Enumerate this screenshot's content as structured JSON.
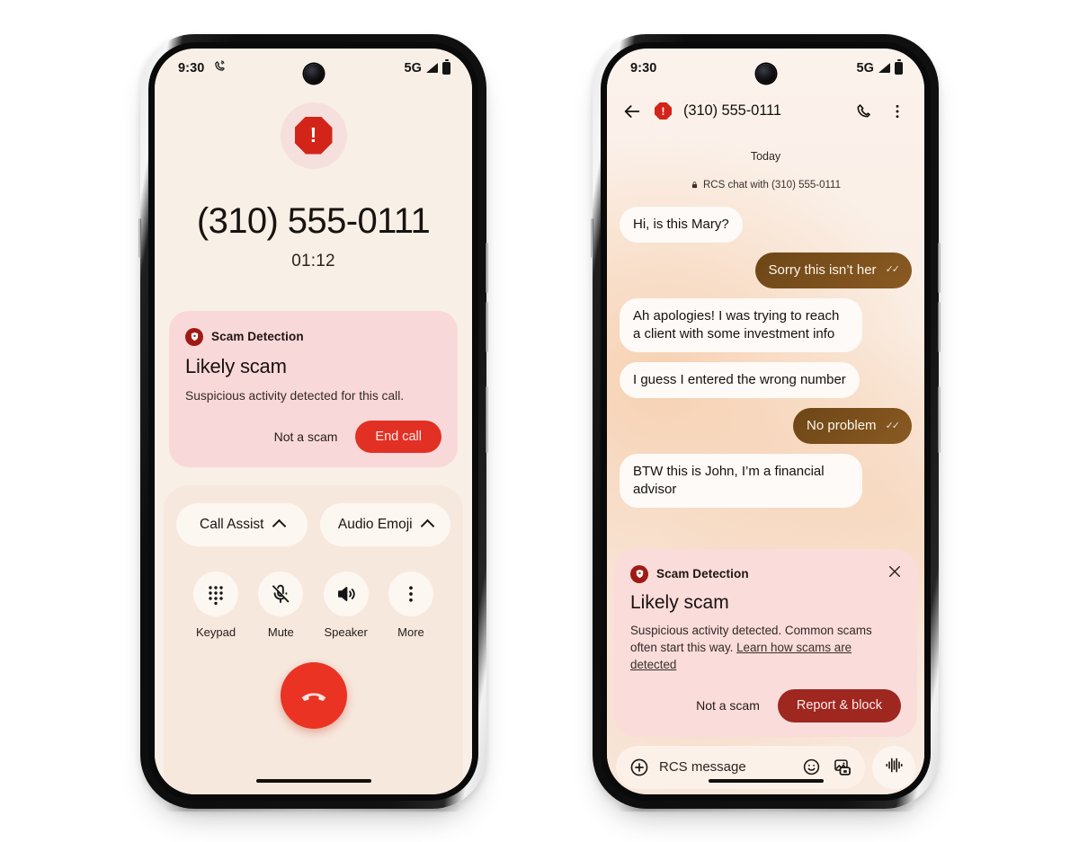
{
  "left_phone": {
    "status_bar": {
      "time": "9:30",
      "call_icon": "phone-in-call-icon",
      "network": "5G",
      "signal_icon": "signal-bars-icon",
      "battery_icon": "battery-icon"
    },
    "call": {
      "alert_icon": "octagon-alert-icon",
      "alert_glyph": "!",
      "number": "(310) 555-0111",
      "duration": "01:12"
    },
    "scam_card": {
      "shield_icon": "shield-scam-icon",
      "header": "Scam Detection",
      "title": "Likely scam",
      "body": "Suspicious activity detected for this call.",
      "secondary_action": "Not a scam",
      "primary_action": "End call",
      "primary_color": "#e23124",
      "card_color": "#f9d8d9"
    },
    "assist_chips": [
      {
        "label": "Call Assist",
        "chevron": "chevron-up-icon"
      },
      {
        "label": "Audio Emoji",
        "chevron": "chevron-up-icon"
      }
    ],
    "controls": [
      {
        "label": "Keypad",
        "icon": "keypad-icon"
      },
      {
        "label": "Mute",
        "icon": "mic-off-icon"
      },
      {
        "label": "Speaker",
        "icon": "speaker-icon"
      },
      {
        "label": "More",
        "icon": "more-vertical-icon"
      }
    ],
    "end_call_button": {
      "icon": "phone-hangup-icon",
      "color": "#ea3323"
    }
  },
  "right_phone": {
    "status_bar": {
      "time": "9:30",
      "network": "5G",
      "signal_icon": "signal-bars-icon",
      "battery_icon": "battery-icon"
    },
    "app_bar": {
      "back_icon": "arrow-back-icon",
      "alert_icon": "octagon-alert-icon",
      "alert_glyph": "!",
      "title": "(310) 555-0111",
      "call_icon": "phone-call-icon",
      "overflow_icon": "more-vertical-icon"
    },
    "thread": {
      "day_separator": "Today",
      "encryption_icon": "lock-icon",
      "encryption_note": "RCS chat with (310) 555-0111",
      "messages": [
        {
          "side": "in",
          "text": "Hi, is this Mary?"
        },
        {
          "side": "out",
          "text": "Sorry this isn’t her",
          "status_icon": "double-check-icon"
        },
        {
          "side": "in",
          "text": "Ah apologies! I was trying to reach a client with some investment info"
        },
        {
          "side": "in",
          "text": "I guess I entered the wrong number"
        },
        {
          "side": "out",
          "text": "No problem",
          "status_icon": "double-check-icon"
        },
        {
          "side": "in",
          "text": "BTW this is John, I’m a financial advisor"
        }
      ]
    },
    "scam_card": {
      "shield_icon": "shield-scam-icon",
      "header": "Scam Detection",
      "close_icon": "close-icon",
      "title": "Likely scam",
      "body_prefix": "Suspicious activity detected. Common scams often start this way. ",
      "body_link": "Learn how scams are detected",
      "secondary_action": "Not a scam",
      "primary_action": "Report & block",
      "primary_color": "#9e2720",
      "card_color": "#fadcdb"
    },
    "composer": {
      "add_icon": "plus-circle-icon",
      "placeholder": "RCS message",
      "emoji_icon": "emoji-smile-icon",
      "gallery_icon": "image-gallery-icon",
      "mic_icon": "voice-waveform-icon"
    }
  }
}
